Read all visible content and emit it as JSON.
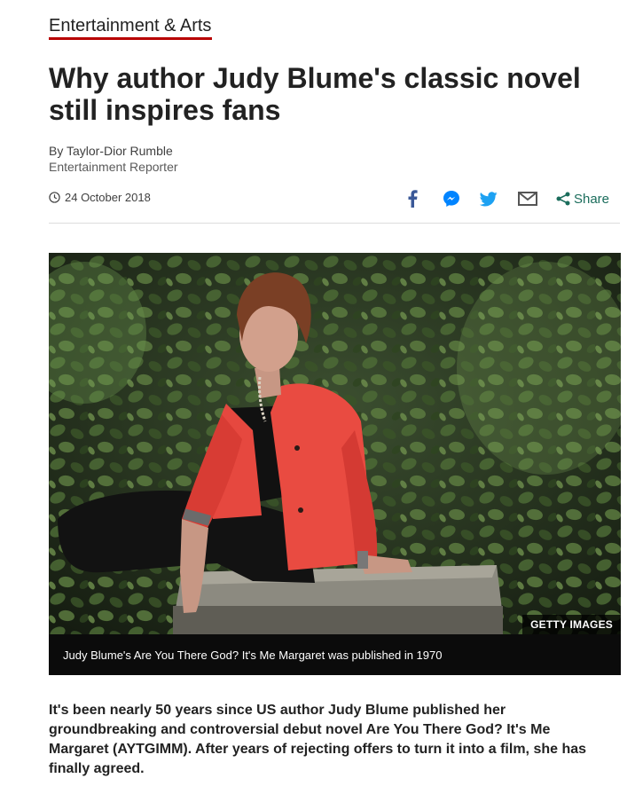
{
  "section": {
    "label": "Entertainment & Arts",
    "accent_color": "#b80000"
  },
  "article": {
    "headline": "Why author Judy Blume's classic novel still inspires fans",
    "author": "By Taylor-Dior Rumble",
    "author_role": "Entertainment Reporter",
    "date": "24 October 2018",
    "intro": "It's been nearly 50 years since US author Judy Blume published her groundbreaking and controversial debut novel Are You There God? It's Me Margaret (AYTGIMM). After years of rejecting offers to turn it into a film, she has finally agreed."
  },
  "share": {
    "icons": [
      "facebook-icon",
      "messenger-icon",
      "twitter-icon",
      "email-icon",
      "share-icon"
    ],
    "share_label": "Share",
    "colors": {
      "facebook": "#3b5998",
      "messenger": "#0084ff",
      "twitter": "#1da1f2",
      "email": "#555555",
      "share": "#1b6d5c"
    }
  },
  "image": {
    "credit": "GETTY IMAGES",
    "caption": "Judy Blume's Are You There God? It's Me Margaret was published in 1970"
  }
}
